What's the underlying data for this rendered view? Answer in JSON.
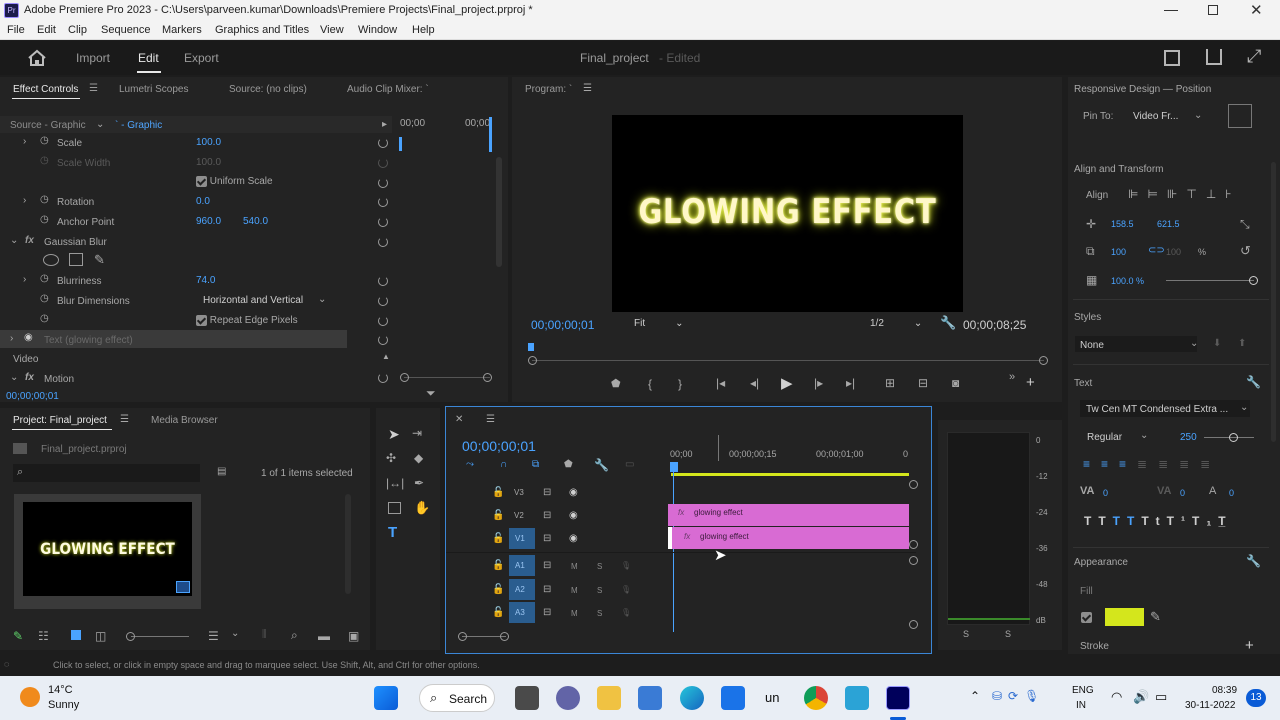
{
  "app": {
    "title": "Adobe Premiere Pro 2023 - C:\\Users\\parveen.kumar\\Downloads\\Premiere Projects\\Final_project.prproj *",
    "icon_label": "Pr"
  },
  "menu": [
    "File",
    "Edit",
    "Clip",
    "Sequence",
    "Markers",
    "Graphics and Titles",
    "View",
    "Window",
    "Help"
  ],
  "workspace": {
    "tabs": [
      "Import",
      "Edit",
      "Export"
    ],
    "active": "Edit",
    "project_name": "Final_project",
    "project_status": "- Edited"
  },
  "effect_controls": {
    "tabs": [
      "Effect Controls",
      "Lumetri Scopes",
      "Source: (no clips)",
      "Audio Clip Mixer: `"
    ],
    "source": "Source - Graphic",
    "clip": "` - Graphic",
    "mini_timecodes": [
      "00;00",
      "00;00"
    ],
    "props": [
      {
        "label": "Scale",
        "value": "100.0"
      },
      {
        "label": "Scale Width",
        "value": "100.0"
      },
      {
        "label": "Uniform Scale"
      },
      {
        "label": "Rotation",
        "value": "0.0"
      },
      {
        "label": "Anchor Point",
        "value": "960.0",
        "value2": "540.0"
      },
      {
        "label": "Gaussian Blur"
      },
      {
        "label": "Blurriness",
        "value": "74.0"
      },
      {
        "label": "Blur Dimensions",
        "value": "Horizontal and Vertical"
      },
      {
        "label": "Repeat Edge Pixels"
      },
      {
        "label": "Text (glowing effect)"
      },
      {
        "label": "Video"
      },
      {
        "label": "Motion"
      }
    ],
    "timecode": "00;00;00;01"
  },
  "program": {
    "title": "Program: `",
    "preview_text": "GLOWING EFFECT",
    "timecode": "00;00;00;01",
    "fit": "Fit",
    "resolution": "1/2",
    "duration": "00;00;08;25"
  },
  "project": {
    "tabs": [
      "Project: Final_project",
      "Media Browser"
    ],
    "file": "Final_project.prproj",
    "selection": "1 of 1 items selected",
    "thumb_text": "GLOWING EFFECT"
  },
  "timeline": {
    "timecode": "00;00;00;01",
    "ruler": [
      "00;00",
      "00;00;00;15",
      "00;00;01;00",
      "0"
    ],
    "video_tracks": [
      "V3",
      "V2",
      "V1"
    ],
    "audio_tracks": [
      "A1",
      "A2",
      "A3"
    ],
    "clips": [
      "glowing effect",
      "glowing effect"
    ],
    "meter_labels": [
      "0",
      "-12",
      "-24",
      "-36",
      "-48",
      "dB"
    ],
    "meter_solo": [
      "S",
      "S"
    ]
  },
  "essential": {
    "title": "Responsive Design — Position",
    "pin_label": "Pin To:",
    "pin_value": "Video Fr...",
    "align_header": "Align and Transform",
    "align_label": "Align",
    "pos_x": "158.5",
    "pos_y": "621.5",
    "scale_w": "100",
    "scale_h": "100",
    "scale_unit": "%",
    "opacity": "100.0 %",
    "styles_header": "Styles",
    "styles_value": "None",
    "text_header": "Text",
    "font": "Tw Cen MT Condensed Extra ...",
    "font_style": "Regular",
    "font_size": "250",
    "tracking": "0",
    "kerning": "0",
    "leading": "0",
    "appearance_header": "Appearance",
    "fill_label": "Fill",
    "stroke_label": "Stroke",
    "fill_color": "#d4e61c"
  },
  "status": "Click to select, or click in empty space and drag to marquee select. Use Shift, Alt, and Ctrl for other options.",
  "taskbar": {
    "weather_temp": "14°C",
    "weather_desc": "Sunny",
    "search": "Search",
    "lang1": "ENG",
    "lang2": "IN",
    "time": "08:39",
    "date": "30-11-2022",
    "notif": "13",
    "un_label": "un"
  },
  "colors": {
    "accent": "#4aa3ff",
    "clip": "#d86bd3",
    "panel": "#232323",
    "fill": "#d4e61c"
  }
}
